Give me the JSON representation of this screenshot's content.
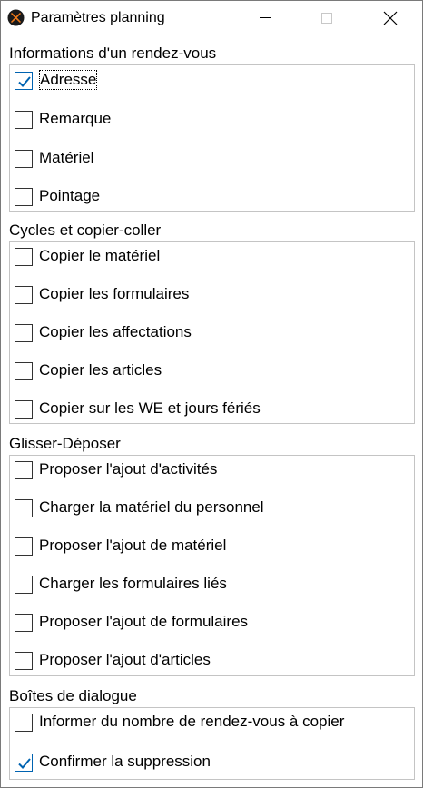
{
  "window": {
    "title": "Paramètres planning",
    "icon": "app-logo-icon",
    "controls": {
      "minimize": "minimize-icon",
      "maximize": "maximize-icon",
      "close": "close-icon"
    }
  },
  "colors": {
    "check": "#0063b1",
    "group_border": "#c4c4c4",
    "checkbox_border": "#333333"
  },
  "groups": [
    {
      "title": "Informations d'un rendez-vous",
      "options": [
        {
          "label": "Adresse",
          "checked": true
        },
        {
          "label": "Remarque",
          "checked": false
        },
        {
          "label": "Matériel",
          "checked": false
        },
        {
          "label": "Pointage",
          "checked": false
        }
      ]
    },
    {
      "title": "Cycles et copier-coller",
      "options": [
        {
          "label": "Copier le matériel",
          "checked": false
        },
        {
          "label": "Copier les formulaires",
          "checked": false
        },
        {
          "label": "Copier les affectations",
          "checked": false
        },
        {
          "label": "Copier les articles",
          "checked": false
        },
        {
          "label": "Copier sur les WE et jours fériés",
          "checked": false
        }
      ]
    },
    {
      "title": "Glisser-Déposer",
      "options": [
        {
          "label": "Proposer l'ajout d'activités",
          "checked": false
        },
        {
          "label": "Charger la matériel du personnel",
          "checked": false
        },
        {
          "label": "Proposer l'ajout de matériel",
          "checked": false
        },
        {
          "label": "Charger les formulaires liés",
          "checked": false
        },
        {
          "label": "Proposer l'ajout de formulaires",
          "checked": false
        },
        {
          "label": "Proposer l'ajout d'articles",
          "checked": false
        }
      ]
    },
    {
      "title": "Boîtes de dialogue",
      "options": [
        {
          "label": "Informer du nombre de rendez-vous à copier",
          "checked": false
        },
        {
          "label": "Confirmer la suppression",
          "checked": true
        }
      ]
    }
  ]
}
